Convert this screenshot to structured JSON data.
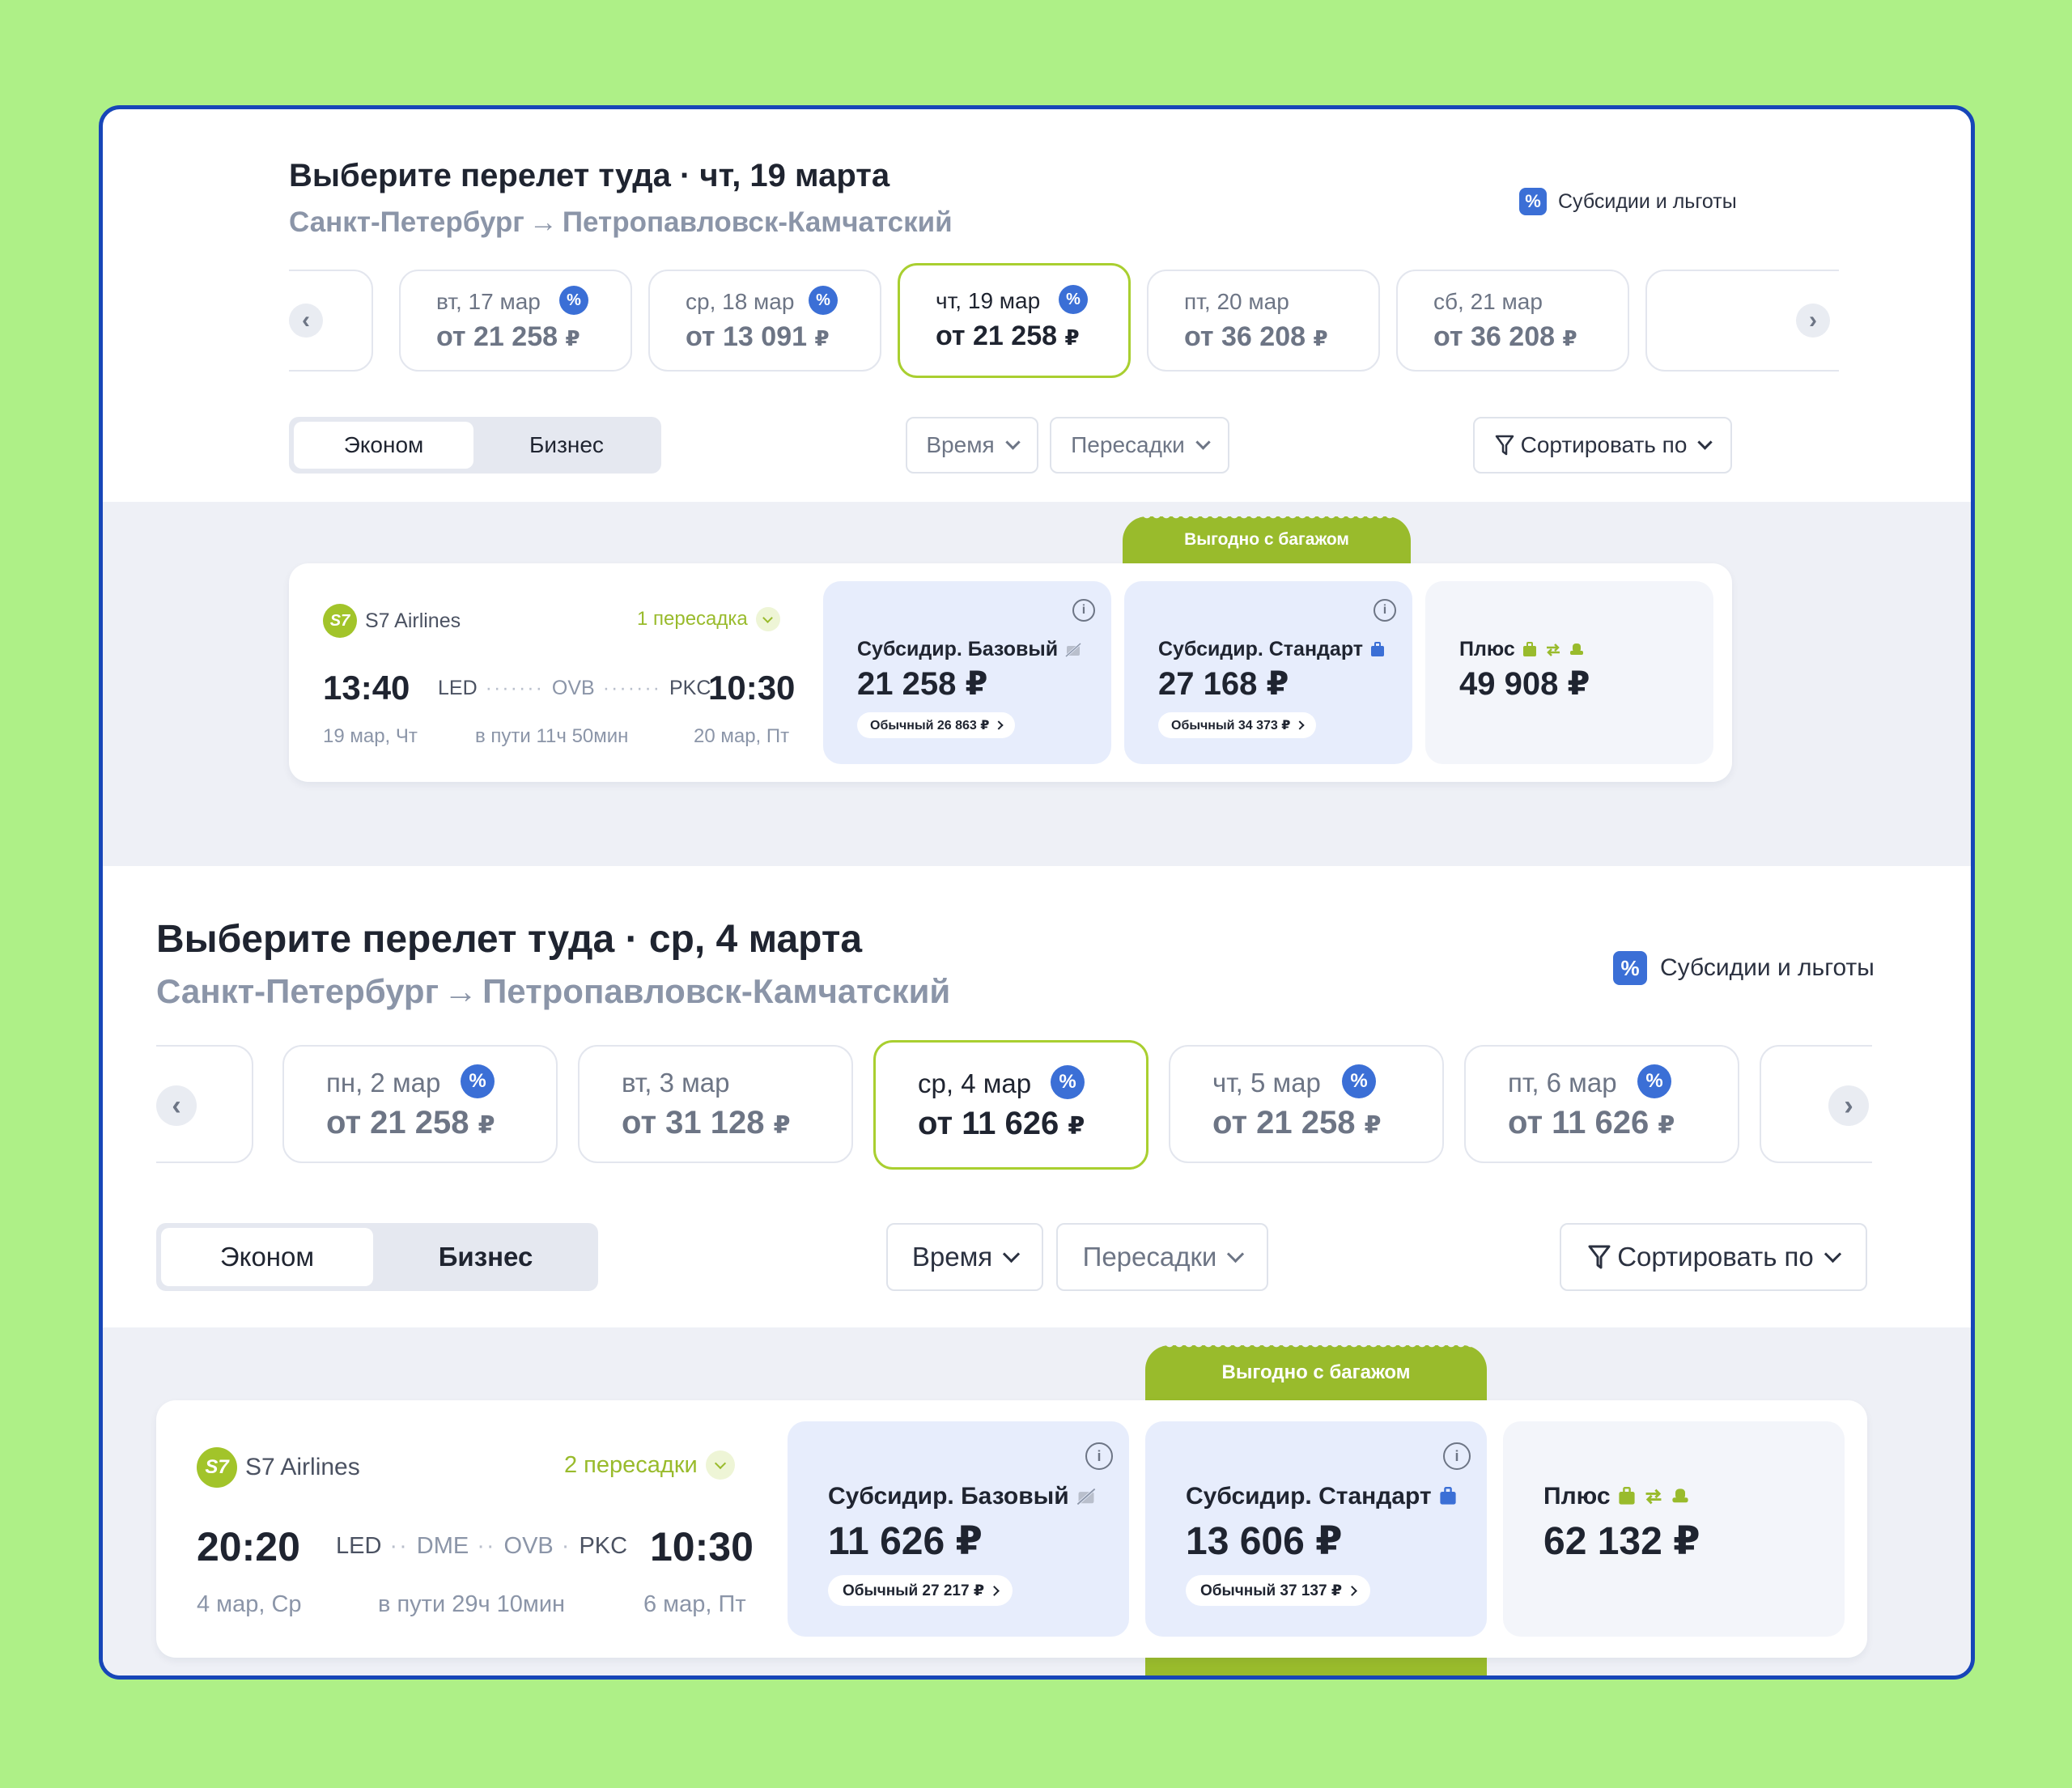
{
  "blocks": [
    {
      "title": "Выберите перелет туда · чт, 19 марта",
      "route_from": "Санкт-Петербург",
      "route_arrow": "→",
      "route_to": "Петропавловск-Камчатский",
      "subsidy_icon": "%",
      "subsidy_label": "Субсидии и льготы",
      "nav_prev": "‹",
      "nav_next": "›",
      "dates": [
        {
          "day": "вт, 17 мар",
          "price": "от 21 258",
          "currency": "₽",
          "badge": "%",
          "selected": false
        },
        {
          "day": "ср, 18 мар",
          "price": "от 13 091",
          "currency": "₽",
          "badge": "%",
          "selected": false
        },
        {
          "day": "чт, 19 мар",
          "price": "от 21 258",
          "currency": "₽",
          "badge": "%",
          "selected": true
        },
        {
          "day": "пт, 20 мар",
          "price": "от 36 208",
          "currency": "₽",
          "badge": "",
          "selected": false
        },
        {
          "day": "сб, 21 мар",
          "price": "от 36 208",
          "currency": "₽",
          "badge": "",
          "selected": false
        }
      ],
      "class_economy": "Эконом",
      "class_business": "Бизнес",
      "filter_time": "Время",
      "filter_transfers": "Пересадки",
      "sort_label": "Сортировать по",
      "ribbon": "Выгодно с багажом",
      "flight": {
        "airline_logo": "S7",
        "airline": "S7 Airlines",
        "stops": "1 пересадка",
        "dep_time": "13:40",
        "arr_time": "10:30",
        "airports": [
          "LED",
          "OVB",
          "PKC"
        ],
        "dep_date": "19 мар, Чт",
        "duration": "в пути 11ч 50мин",
        "arr_date": "20 мар, Пт",
        "fares": [
          {
            "name": "Субсидир. Базовый",
            "price": "21 258 ₽",
            "regular": "Обычный 26 863 ₽",
            "info": "i"
          },
          {
            "name": "Субсидир. Стандарт",
            "price": "27 168 ₽",
            "regular": "Обычный 34 373 ₽",
            "info": "i"
          },
          {
            "name": "Плюс",
            "price": "49 908 ₽",
            "regular": "",
            "info": ""
          }
        ]
      }
    },
    {
      "title": "Выберите перелет туда · ср, 4 марта",
      "route_from": "Санкт-Петербург",
      "route_arrow": "→",
      "route_to": "Петропавловск-Камчатский",
      "subsidy_icon": "%",
      "subsidy_label": "Субсидии и льготы",
      "nav_prev": "‹",
      "nav_next": "›",
      "dates": [
        {
          "day": "пн, 2 мар",
          "price": "от 21 258",
          "currency": "₽",
          "badge": "%",
          "selected": false
        },
        {
          "day": "вт, 3 мар",
          "price": "от 31 128",
          "currency": "₽",
          "badge": "",
          "selected": false
        },
        {
          "day": "ср, 4 мар",
          "price": "от 11 626",
          "currency": "₽",
          "badge": "%",
          "selected": true
        },
        {
          "day": "чт, 5 мар",
          "price": "от 21 258",
          "currency": "₽",
          "badge": "%",
          "selected": false
        },
        {
          "day": "пт, 6 мар",
          "price": "от 11 626",
          "currency": "₽",
          "badge": "%",
          "selected": false
        }
      ],
      "class_economy": "Эконом",
      "class_business": "Бизнес",
      "filter_time": "Время",
      "filter_transfers": "Пересадки",
      "sort_label": "Сортировать по",
      "ribbon": "Выгодно с багажом",
      "flight": {
        "airline_logo": "S7",
        "airline": "S7 Airlines",
        "stops": "2 пересадки",
        "dep_time": "20:20",
        "arr_time": "10:30",
        "airports": [
          "LED",
          "DME",
          "OVB",
          "PKC"
        ],
        "dep_date": "4 мар, Ср",
        "duration": "в пути 29ч 10мин",
        "arr_date": "6 мар, Пт",
        "fares": [
          {
            "name": "Субсидир. Базовый",
            "price": "11 626 ₽",
            "regular": "Обычный 27 217 ₽",
            "info": "i"
          },
          {
            "name": "Субсидир. Стандарт",
            "price": "13 606 ₽",
            "regular": "Обычный 37 137 ₽",
            "info": "i"
          },
          {
            "name": "Плюс",
            "price": "62 132 ₽",
            "regular": "",
            "info": ""
          }
        ]
      }
    }
  ],
  "colors": {
    "accent_green": "#99bb2c",
    "badge_blue": "#3b6fd6",
    "frame_blue": "#1746b8",
    "background": "#aef087"
  }
}
